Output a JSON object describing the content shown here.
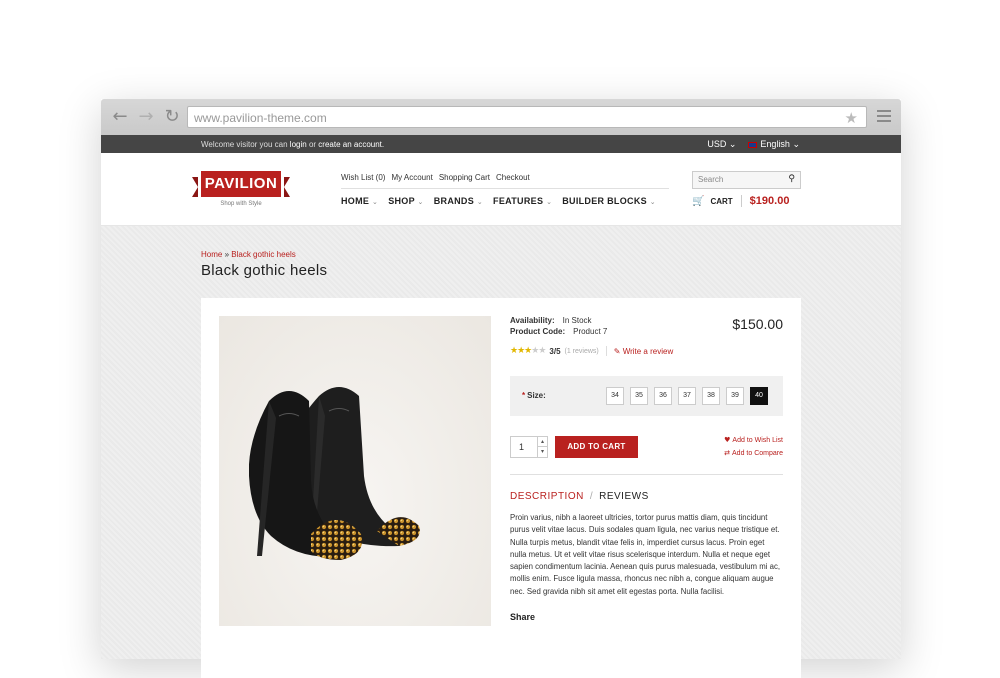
{
  "browser": {
    "url": "www.pavilion-theme.com"
  },
  "topbar": {
    "welcome_prefix": "Welcome visitor you can",
    "login": "login",
    "or": "or",
    "create": "create an account.",
    "currency": "USD",
    "language": "English"
  },
  "header": {
    "logo": "PAVILION",
    "tagline": "Shop with Style",
    "toplinks": [
      "Wish List (0)",
      "My Account",
      "Shopping Cart",
      "Checkout"
    ],
    "nav": [
      "HOME",
      "SHOP",
      "BRANDS",
      "FEATURES",
      "BUILDER BLOCKS"
    ],
    "search_placeholder": "Search",
    "cart_label": "CART",
    "cart_total": "$190.00"
  },
  "page": {
    "breadcrumb_home": "Home",
    "breadcrumb_sep": "»",
    "breadcrumb_current": "Black gothic heels",
    "title": "Black gothic heels"
  },
  "product": {
    "availability_label": "Availability:",
    "availability_value": "In Stock",
    "code_label": "Product Code:",
    "code_value": "Product 7",
    "price": "$150.00",
    "rating": 3,
    "rating_max": 5,
    "rating_text": "3/5",
    "reviews_count": "(1 reviews)",
    "write_review": "Write a review",
    "size_label": "Size:",
    "sizes": [
      "34",
      "35",
      "36",
      "37",
      "38",
      "39",
      "40"
    ],
    "selected_size": "40",
    "quantity": "1",
    "add_to_cart": "ADD TO CART",
    "add_to_wishlist": "Add to Wish List",
    "add_to_compare": "Add to Compare",
    "tab_description": "DESCRIPTION",
    "tab_reviews": "REVIEWS",
    "description": "Proin varius, nibh a laoreet ultricies, tortor purus mattis diam, quis tincidunt purus velit vitae lacus. Duis sodales quam ligula, nec varius neque tristique et. Nulla turpis metus, blandit vitae felis in, imperdiet cursus lacus. Proin eget nulla metus. Ut et velit vitae risus scelerisque interdum. Nulla et neque eget sapien condimentum lacinia. Aenean quis purus malesuada, vestibulum mi ac, mollis enim. Fusce ligula massa, rhoncus nec nibh a, congue aliquam augue nec. Sed gravida nibh sit amet elit egestas porta. Nulla facilisi.",
    "share": "Share"
  },
  "colors": {
    "brand": "#b9211f",
    "topbar": "#454545"
  }
}
